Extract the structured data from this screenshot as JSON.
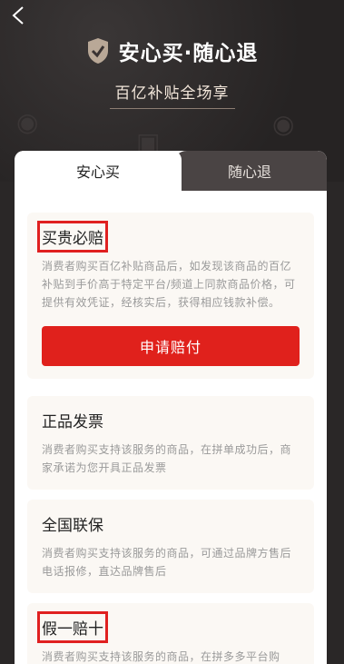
{
  "header": {
    "title": "安心买·随心退",
    "subtitle": "百亿补贴全场享"
  },
  "tabs": [
    {
      "label": "安心买",
      "active": true
    },
    {
      "label": "随心退",
      "active": false
    }
  ],
  "sections": [
    {
      "title": "买贵必赔",
      "desc": "消费者购买百亿补贴商品后，如发现该商品的百亿补贴到手价高于特定平台/频道上同款商品价格，可提供有效凭证，经核实后，获得相应钱款补偿。",
      "button": "申请赔付"
    },
    {
      "title": "正品发票",
      "desc": "消费者购买支持该服务的商品，在拼单成功后，商家承诺为您开具正品发票"
    },
    {
      "title": "全国联保",
      "desc": "消费者购买支持该服务的商品，可通过品牌方售后电话报修，直达品牌售后"
    },
    {
      "title": "假一赔十",
      "desc": "消费者购买支持该服务的商品，在拼多多平台购"
    }
  ],
  "colors": {
    "accent": "#e0211c",
    "header_bg": "#262323",
    "highlight_box": "#e02020"
  },
  "icons": {
    "back": "chevron-left-icon",
    "shield": "shield-check-icon"
  }
}
